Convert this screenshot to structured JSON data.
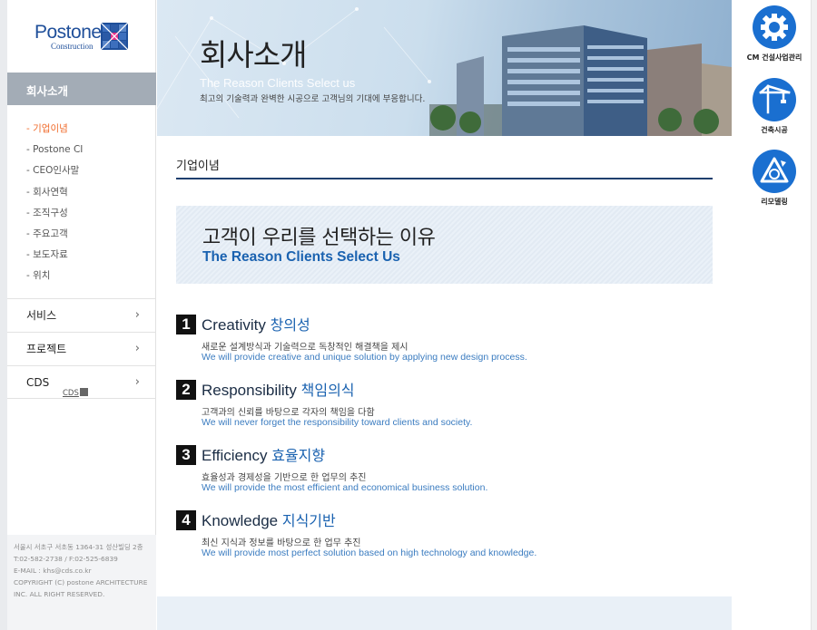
{
  "brand": {
    "name": "Postone",
    "sub": "Construction"
  },
  "sidebar": {
    "section_title": "회사소개",
    "sub_items": [
      {
        "label": "- 기업이념",
        "active": true
      },
      {
        "label": "- Postone CI",
        "active": false
      },
      {
        "label": "- CEO인사말",
        "active": false
      },
      {
        "label": "- 회사연혁",
        "active": false
      },
      {
        "label": "- 조직구성",
        "active": false
      },
      {
        "label": "- 주요고객",
        "active": false
      },
      {
        "label": "- 보도자료",
        "active": false
      },
      {
        "label": "- 위치",
        "active": false
      }
    ],
    "main_items": [
      {
        "label": "서비스"
      },
      {
        "label": "프로젝트"
      },
      {
        "label": "CDS",
        "badge": "CDS"
      }
    ],
    "chevron": "›",
    "footer": {
      "address": "서울시 서초구 서초동 1364-31 성산빌딩 2층",
      "phone": "T:02-582-2738 / F:02-525-6839",
      "email": "E-MAIL : khs@cds.co.kr",
      "copyright": "COPYRIGHT (C) postone ARCHITECTURE INC. ALL RIGHT RESERVED."
    }
  },
  "banner": {
    "title": "회사소개",
    "subtitle_en": "The Reason Clients Select us",
    "subtitle_ko": "최고의 기술력과 완벽한 시공으로 고객님의 기대에 부응합니다."
  },
  "page": {
    "title": "기업이념",
    "hero_ko": "고객이 우리를 선택하는 이유",
    "hero_en": "The Reason Clients Select Us"
  },
  "features": [
    {
      "num": "1",
      "title_en": "Creativity",
      "title_ko": "창의성",
      "desc_ko": "새로운 설계방식과 기술력으로 독창적인 해결책을 제시",
      "desc_en": "We will provide creative and unique solution by applying new design process."
    },
    {
      "num": "2",
      "title_en": "Responsibility",
      "title_ko": "책임의식",
      "desc_ko": "고객과의 신뢰를 바탕으로 각자의 책임을 다함",
      "desc_en": "We will never forget the responsibility toward clients and society."
    },
    {
      "num": "3",
      "title_en": "Efficiency",
      "title_ko": "효율지향",
      "desc_ko": "효율성과 경제성을 기반으로 한 업무의 추진",
      "desc_en": "We will provide the most efficient and economical business solution."
    },
    {
      "num": "4",
      "title_en": "Knowledge",
      "title_ko": "지식기반",
      "desc_ko": "최신 지식과 정보를 바탕으로 한 업무 추진",
      "desc_en": "We will provide most perfect solution based on high technology and  knowledge."
    }
  ],
  "quick_menu": [
    {
      "label": "CM 건설사업관리",
      "icon": "gear-icon"
    },
    {
      "label": "건축시공",
      "icon": "crane-icon"
    },
    {
      "label": "리모델링",
      "icon": "recycle-icon"
    }
  ],
  "colors": {
    "brand_blue": "#1f4f9a",
    "accent_blue": "#1a62b0",
    "active_orange": "#f06a2a",
    "quick_blue": "#1a6fd0"
  }
}
